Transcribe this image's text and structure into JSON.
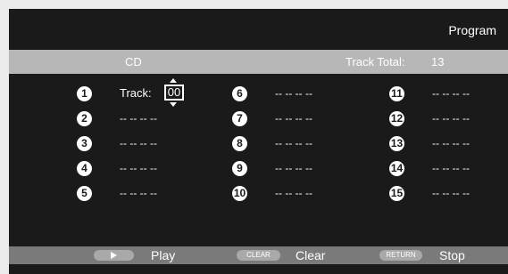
{
  "header": {
    "title": "Program"
  },
  "info": {
    "source": "CD",
    "track_total_label": "Track Total:",
    "track_total_value": "13"
  },
  "editor": {
    "track_label": "Track:",
    "track_value": "00"
  },
  "slots": [
    {
      "num": "1",
      "value": ""
    },
    {
      "num": "2",
      "value": "-- -- -- --"
    },
    {
      "num": "3",
      "value": "-- -- -- --"
    },
    {
      "num": "4",
      "value": "-- -- -- --"
    },
    {
      "num": "5",
      "value": "-- -- -- --"
    },
    {
      "num": "6",
      "value": "-- -- -- --"
    },
    {
      "num": "7",
      "value": "-- -- -- --"
    },
    {
      "num": "8",
      "value": "-- -- -- --"
    },
    {
      "num": "9",
      "value": "-- -- -- --"
    },
    {
      "num": "10",
      "value": "-- -- -- --"
    },
    {
      "num": "11",
      "value": "-- -- -- --"
    },
    {
      "num": "12",
      "value": "-- -- -- --"
    },
    {
      "num": "13",
      "value": "-- -- -- --"
    },
    {
      "num": "14",
      "value": "-- -- -- --"
    },
    {
      "num": "15",
      "value": "-- -- -- --"
    }
  ],
  "footer": {
    "play_icon": "play-icon",
    "play_label": "Play",
    "clear_key": "CLEAR",
    "clear_label": "Clear",
    "return_key": "RETURN",
    "stop_label": "Stop"
  },
  "colors": {
    "screen_bg": "#1a1a1a",
    "info_bar": "#b7b7b7",
    "footer_bar": "#7a7a7a",
    "key_pill": "#a9a9a9"
  }
}
